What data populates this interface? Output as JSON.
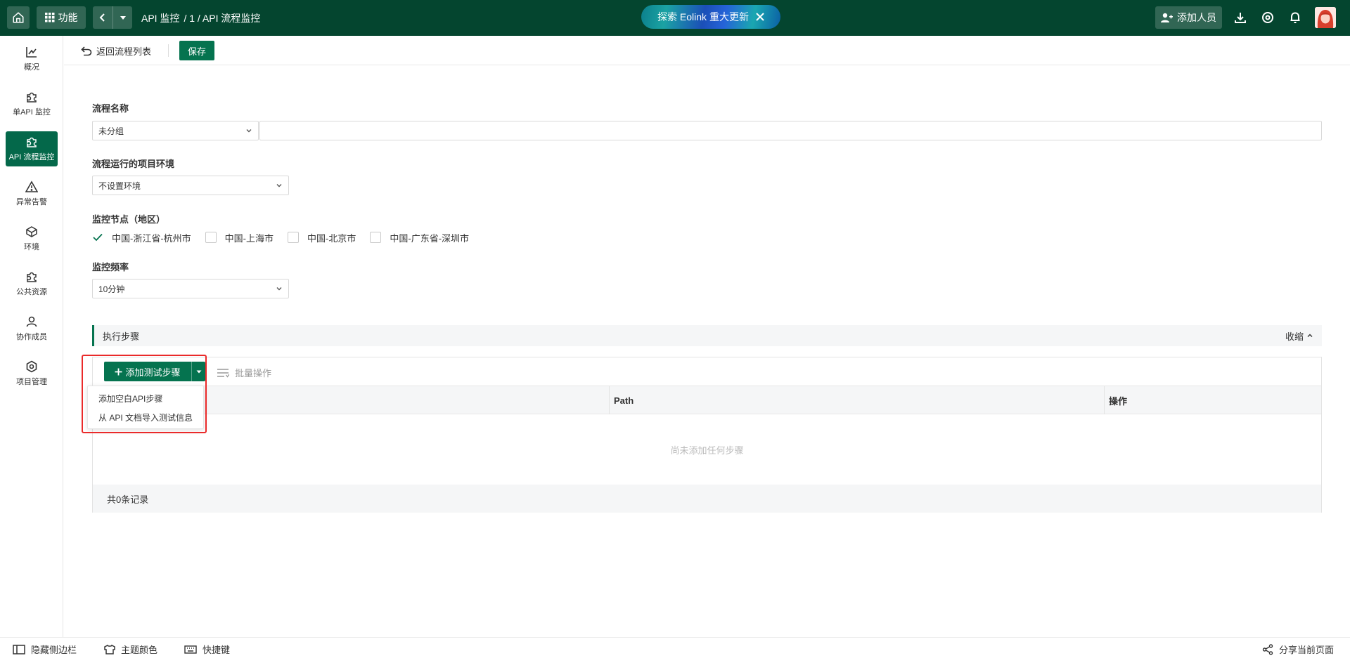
{
  "topbar": {
    "func_label": "功能",
    "breadcrumb": [
      "API 监控",
      "/ 1 / API 流程监控"
    ],
    "news": "探索 Eolink 重大更新",
    "add_member": "添加人员"
  },
  "sidebar": {
    "items": [
      {
        "label": "概况",
        "icon": "chart-icon"
      },
      {
        "label": "单API 监控",
        "icon": "puzzle-icon"
      },
      {
        "label": "API 流程监控",
        "icon": "puzzle-icon"
      },
      {
        "label": "异常告警",
        "icon": "warning-icon"
      },
      {
        "label": "环境",
        "icon": "cube-icon"
      },
      {
        "label": "公共资源",
        "icon": "puzzle-icon"
      },
      {
        "label": "协作成员",
        "icon": "user-icon"
      },
      {
        "label": "项目管理",
        "icon": "gear-icon"
      }
    ]
  },
  "toolbar": {
    "back_label": "返回流程列表",
    "save_label": "保存"
  },
  "form": {
    "name_label": "流程名称",
    "group_value": "未分组",
    "name_value": "",
    "env_label": "流程运行的项目环境",
    "env_value": "不设置环境",
    "nodes_label": "监控节点（地区）",
    "nodes": [
      {
        "label": "中国-浙江省-杭州市",
        "checked": true
      },
      {
        "label": "中国-上海市",
        "checked": false
      },
      {
        "label": "中国-北京市",
        "checked": false
      },
      {
        "label": "中国-广东省-深圳市",
        "checked": false
      }
    ],
    "freq_label": "监控频率",
    "freq_value": "10分钟"
  },
  "steps": {
    "title": "执行步骤",
    "collapse_label": "收缩",
    "add_label": "添加测试步骤",
    "batch_label": "批量操作",
    "columns": [
      "Path",
      "操作"
    ],
    "empty_text": "尚未添加任何步骤",
    "footer": "共0条记录",
    "dropdown": [
      "添加空白API步骤",
      "从 API 文档导入测试信息"
    ]
  },
  "footer": {
    "hide_sidebar": "隐藏侧边栏",
    "theme": "主题颜色",
    "shortcuts": "快捷键",
    "share": "分享当前页面"
  },
  "colors": {
    "brand_dark": "#04452f",
    "brand": "#05734f",
    "highlight": "#ea2a2a"
  }
}
